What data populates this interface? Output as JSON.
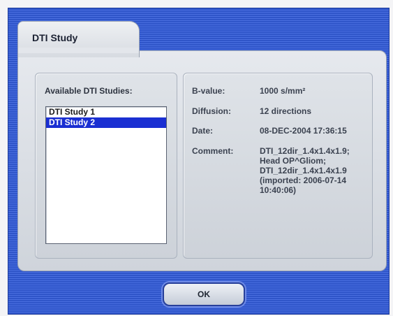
{
  "dialog": {
    "tab_title": "DTI Study",
    "left_panel": {
      "label": "Available DTI Studies:",
      "studies": [
        {
          "name": "DTI Study 1",
          "selected": false
        },
        {
          "name": "DTI Study 2",
          "selected": true
        }
      ]
    },
    "details": {
      "bvalue_label": "B-value:",
      "bvalue": "1000 s/mm²",
      "diffusion_label": "Diffusion:",
      "diffusion": "12 directions",
      "date_label": "Date:",
      "date": "08-DEC-2004 17:36:15",
      "comment_label": "Comment:",
      "comment_lines": [
        "DTI_12dir_1.4x1.4x1.9;",
        "Head OP^Gliom;",
        "DTI_12dir_1.4x1.4x1.9",
        "(imported: 2006-07-14",
        "10:40:06)"
      ]
    },
    "ok_label": "OK"
  },
  "colors": {
    "accent": "#1a2fd2",
    "stripe_dark": "#2f55c9",
    "stripe_light": "#4a6fe0"
  }
}
